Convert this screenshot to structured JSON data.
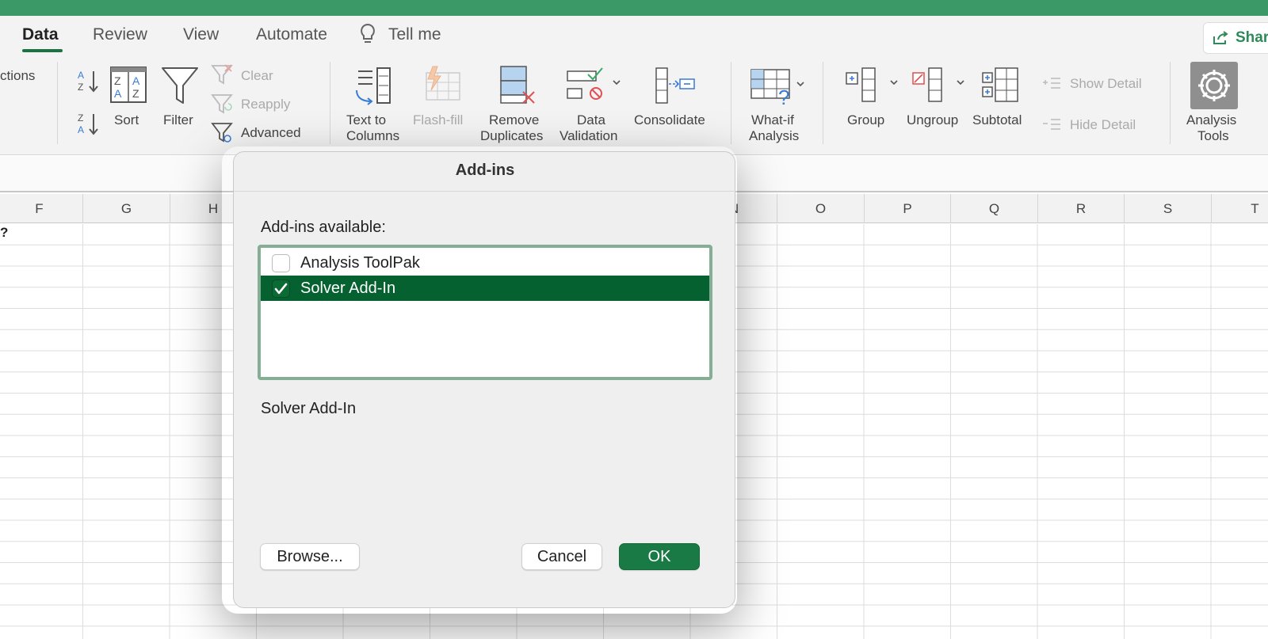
{
  "tabs": [
    {
      "label": "Data",
      "active": true
    },
    {
      "label": "Review"
    },
    {
      "label": "View"
    },
    {
      "label": "Automate"
    }
  ],
  "tell_me": "Tell me",
  "share": "Shar",
  "ribbon": {
    "connections_partial": "ctions",
    "sort": "Sort",
    "filter": "Filter",
    "clear": "Clear",
    "reapply": "Reapply",
    "advanced": "Advanced",
    "text_to_columns_1": "Text to",
    "text_to_columns_2": "Columns",
    "flash_fill": "Flash-fill",
    "remove_duplicates_1": "Remove",
    "remove_duplicates_2": "Duplicates",
    "data_validation_1": "Data",
    "data_validation_2": "Validation",
    "consolidate": "Consolidate",
    "what_if_1": "What-if",
    "what_if_2": "Analysis",
    "group": "Group",
    "ungroup": "Ungroup",
    "subtotal": "Subtotal",
    "show_detail": "Show Detail",
    "hide_detail": "Hide Detail",
    "analysis_tools_1": "Analysis",
    "analysis_tools_2": "Tools"
  },
  "columns": [
    "F",
    "G",
    "H",
    "",
    "",
    "",
    "",
    "",
    "N",
    "O",
    "P",
    "Q",
    "R",
    "S",
    "T"
  ],
  "cell_f1": "?",
  "dialog": {
    "title": "Add-ins",
    "available_label": "Add-ins available:",
    "items": [
      {
        "label": "Analysis ToolPak",
        "checked": false,
        "selected": false
      },
      {
        "label": "Solver Add-In",
        "checked": true,
        "selected": true
      }
    ],
    "description": "Solver Add-In",
    "browse": "Browse...",
    "cancel": "Cancel",
    "ok": "OK"
  },
  "colors": {
    "titlebar": "#3a9966",
    "accent": "#1e7145",
    "selection": "#05612f",
    "ok_button": "#1a7a45"
  }
}
